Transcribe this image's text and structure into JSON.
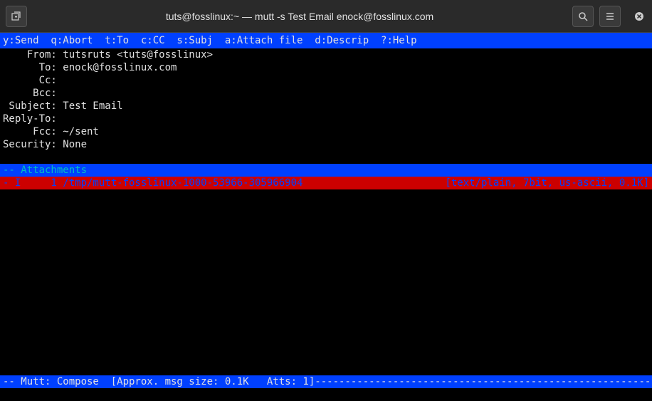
{
  "titlebar": {
    "title": "tuts@fosslinux:~ — mutt -s Test Email enock@fosslinux.com"
  },
  "menu": {
    "line": "y:Send  q:Abort  t:To  c:CC  s:Subj  a:Attach file  d:Descrip  ?:Help"
  },
  "headers": {
    "from_label": "    From:",
    "from_value": " tutsruts <tuts@fosslinux>",
    "to_label": "      To:",
    "to_value": " enock@fosslinux.com",
    "cc_label": "      Cc:",
    "cc_value": "",
    "bcc_label": "     Bcc:",
    "bcc_value": "",
    "subject_label": " Subject:",
    "subject_value": " Test Email",
    "replyto_label": "Reply-To:",
    "replyto_value": "",
    "fcc_label": "     Fcc:",
    "fcc_value": " ~/sent",
    "security_label": "Security:",
    "security_value": " None"
  },
  "attachments": {
    "header": "-- Attachments",
    "item_left": "- I     1 /tmp/mutt-fosslinux-1000-53966-305966904",
    "item_right": "[text/plain, 7bit, us-ascii, 0.1K]"
  },
  "status": {
    "line": "-- Mutt: Compose  [Approx. msg size: 0.1K   Atts: 1]---------------------------------------------------------------"
  }
}
